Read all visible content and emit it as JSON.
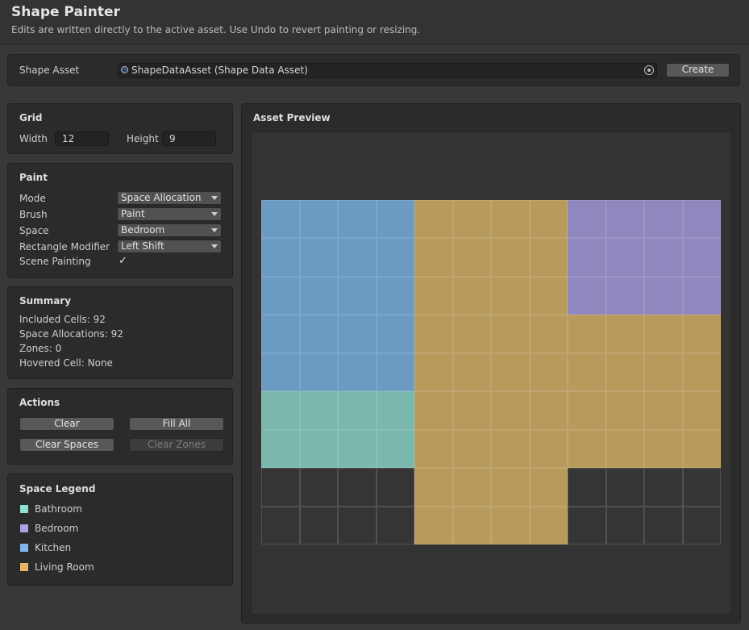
{
  "header": {
    "title": "Shape Painter",
    "subtitle": "Edits are written directly to the active asset. Use Undo to revert painting or resizing."
  },
  "asset_bar": {
    "label": "Shape Asset",
    "value": "ShapeDataAsset (Shape Data Asset)",
    "create_label": "Create"
  },
  "grid": {
    "header": "Grid",
    "width_label": "Width",
    "width_value": "12",
    "height_label": "Height",
    "height_value": "9"
  },
  "paint": {
    "header": "Paint",
    "mode_label": "Mode",
    "mode_value": "Space Allocation",
    "brush_label": "Brush",
    "brush_value": "Paint",
    "space_label": "Space",
    "space_value": "Bedroom",
    "rect_label": "Rectangle Modifier",
    "rect_value": "Left Shift",
    "scene_label": "Scene Painting",
    "scene_checked": "✓"
  },
  "summary": {
    "header": "Summary",
    "included": "Included Cells: 92",
    "allocations": "Space Allocations: 92",
    "zones": "Zones: 0",
    "hovered": "Hovered Cell: None"
  },
  "actions": {
    "header": "Actions",
    "clear": "Clear",
    "fill_all": "Fill All",
    "clear_spaces": "Clear Spaces",
    "clear_zones": "Clear Zones"
  },
  "legend": {
    "header": "Space Legend",
    "items": [
      {
        "label": "Bathroom",
        "color": "#8fe0d2"
      },
      {
        "label": "Bedroom",
        "color": "#ad9fe0"
      },
      {
        "label": "Kitchen",
        "color": "#80b7ea"
      },
      {
        "label": "Living Room",
        "color": "#e6b866"
      }
    ]
  },
  "preview": {
    "header": "Asset Preview",
    "columns": 12,
    "rows": 9,
    "cell_colors": {
      "K": "#6b9bc3",
      "L": "#b89a5d",
      "B": "#8f87bd",
      "T": "#7ab8ae",
      "E": "#353535"
    },
    "cells": [
      "KKKKLLLLBBBB",
      "KKKKLLLLBBBB",
      "KKKKLLLLBBBB",
      "KKKKLLLLLLLL",
      "KKKKLLLLLLLL",
      "TTTTLLLLLLLL",
      "TTTTLLLLLLLL",
      "EEEELLLLEEEE",
      "EEEELLLLEEEE"
    ]
  }
}
